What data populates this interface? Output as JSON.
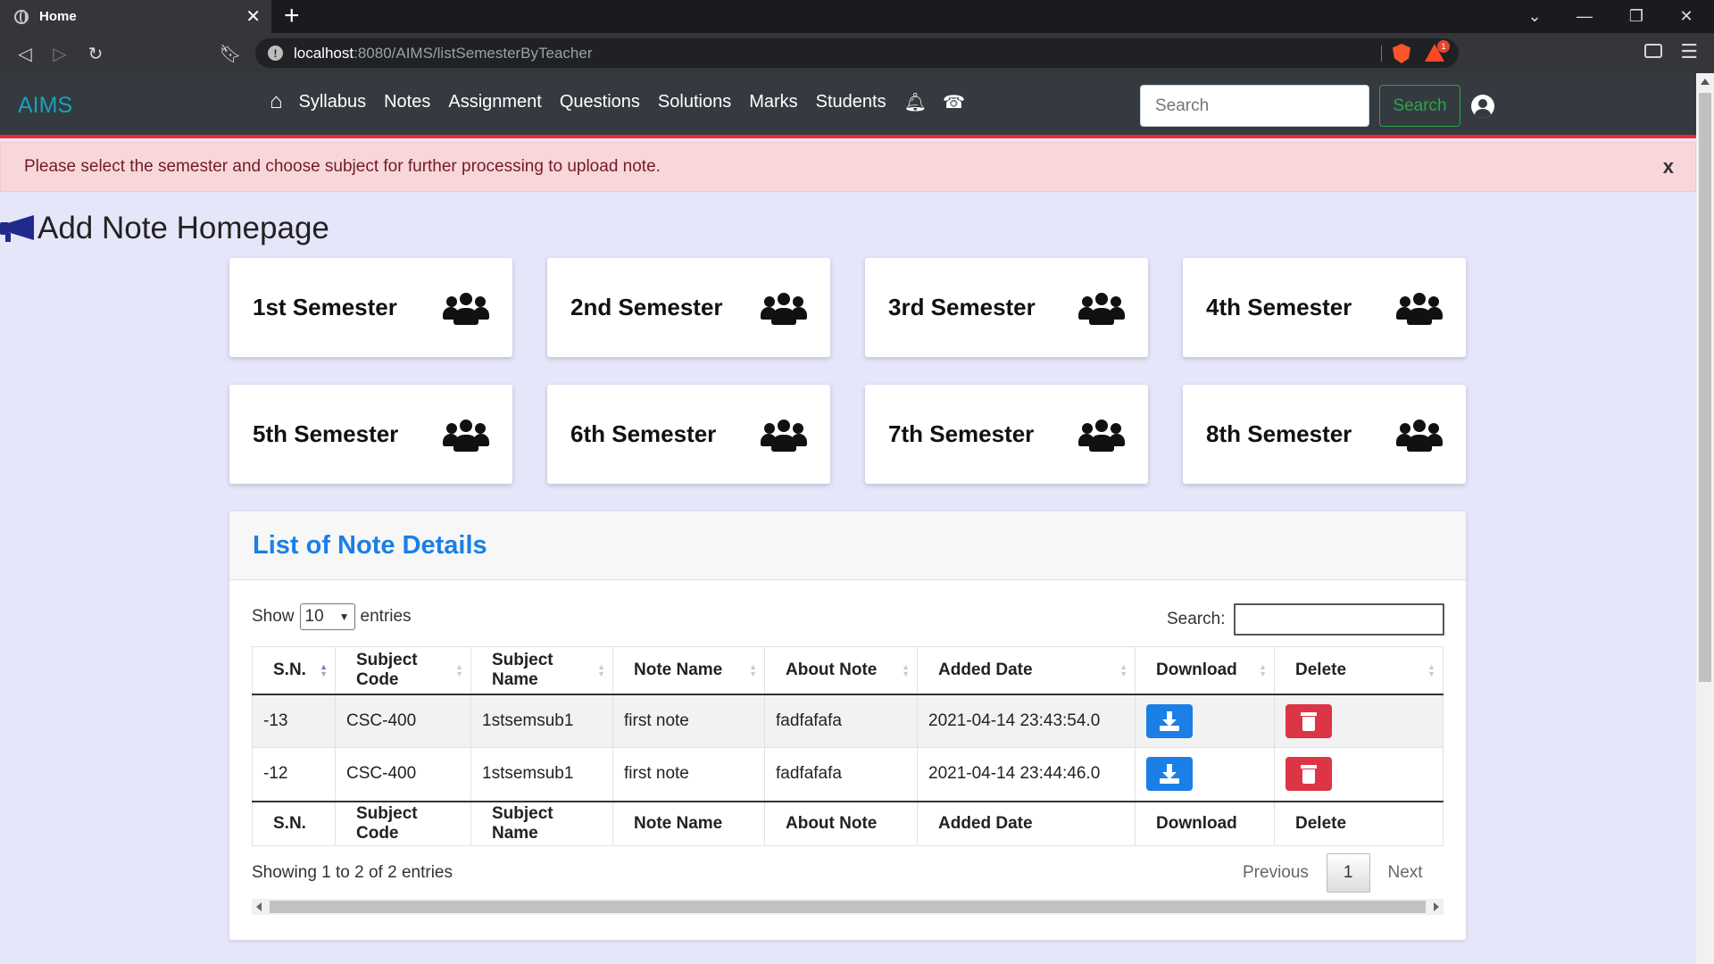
{
  "browser": {
    "tab_title": "Home",
    "tab_close": "✕",
    "new_tab": "+",
    "url_host": "localhost",
    "url_path": ":8080/AIMS/listSemesterByTeacher",
    "bat_badge": "1"
  },
  "navbar": {
    "brand": "AIMS",
    "links": [
      "Syllabus",
      "Notes",
      "Assignment",
      "Questions",
      "Solutions",
      "Marks",
      "Students"
    ],
    "search_placeholder": "Search",
    "search_button": "Search"
  },
  "alert": {
    "message": "Please select the semester and choose subject for further processing to upload note.",
    "close": "x"
  },
  "page": {
    "title": "Add Note Homepage"
  },
  "semesters": [
    "1st Semester",
    "2nd Semester",
    "3rd Semester",
    "4th Semester",
    "5th Semester",
    "6th Semester",
    "7th Semester",
    "8th Semester"
  ],
  "notes_panel": {
    "title": "List of Note Details",
    "show_label": "Show",
    "entries_label": "entries",
    "page_length": "10",
    "search_label": "Search:",
    "columns": [
      "S.N.",
      "Subject Code",
      "Subject Name",
      "Note Name",
      "About Note",
      "Added Date",
      "Download",
      "Delete"
    ],
    "rows": [
      {
        "sn": "-13",
        "subject_code": "CSC-400",
        "subject_name": "1stsemsub1",
        "note_name": "first note",
        "about": "fadfafafa",
        "added": "2021-04-14 23:43:54.0"
      },
      {
        "sn": "-12",
        "subject_code": "CSC-400",
        "subject_name": "1stsemsub1",
        "note_name": "first note",
        "about": "fadfafafa",
        "added": "2021-04-14 23:44:46.0"
      }
    ],
    "info": "Showing 1 to 2 of 2 entries",
    "pager": {
      "previous": "Previous",
      "current": "1",
      "next": "Next"
    }
  }
}
